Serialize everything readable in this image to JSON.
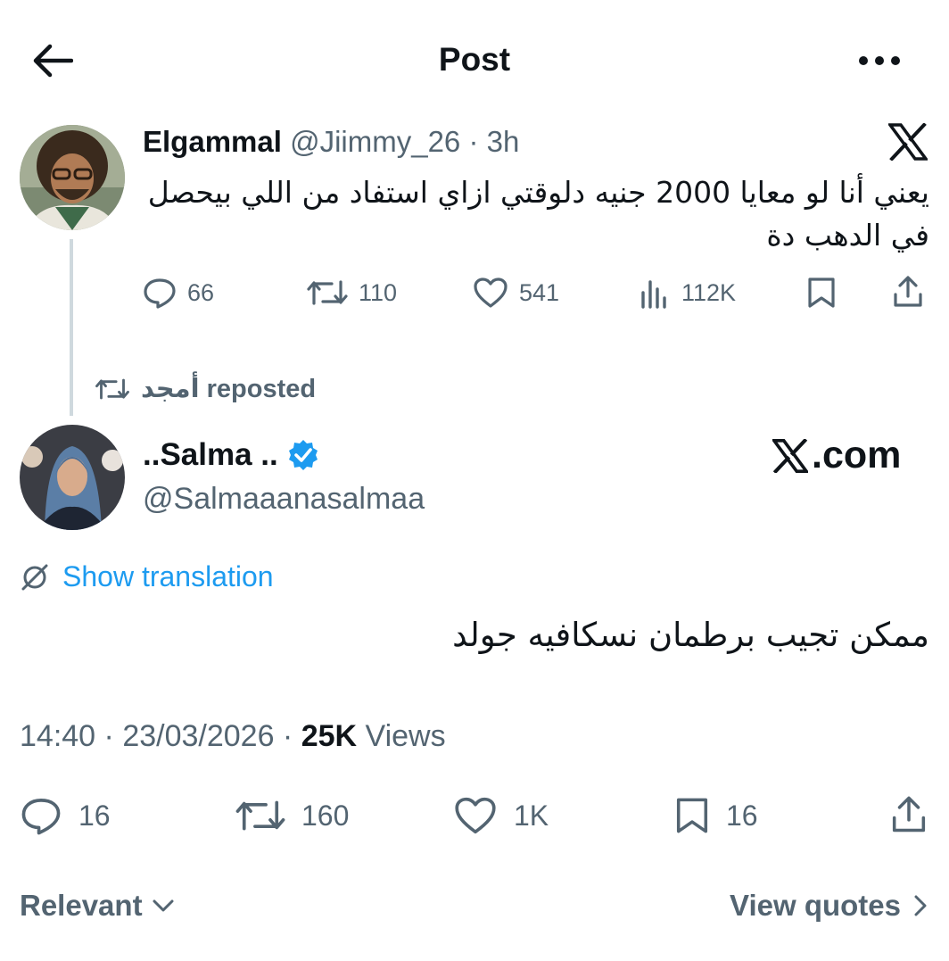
{
  "header": {
    "title": "Post"
  },
  "quoted": {
    "display_name": "Elgammal",
    "handle": "@Jiimmy_26",
    "separator": "·",
    "age": "3h",
    "text": "يعني أنا لو معايا 2000 جنيه دلوقتي ازاي استفاد من اللي بيحصل في الدهب دة",
    "stats": {
      "replies": "66",
      "reposts": "110",
      "likes": "541",
      "views": "112K"
    }
  },
  "repost_banner": {
    "text": "أمجد reposted"
  },
  "post": {
    "display_name": "..Salma ..",
    "handle": "@Salmaaanasalmaa",
    "watermark": ".com",
    "translate_label": "Show translation",
    "text": "ممكن تجيب برطمان نسكافيه جولد",
    "time": "14:40",
    "date": "23/03/2026",
    "sep": " · ",
    "views_count": "25K",
    "views_label": " Views",
    "stats": {
      "replies": "16",
      "reposts": "160",
      "likes": "1K",
      "bookmarks": "16"
    }
  },
  "footer": {
    "sort_label": "Relevant",
    "view_quotes_label": "View quotes"
  },
  "colors": {
    "text": "#0f1419",
    "muted": "#536471",
    "accent": "#1d9bf0"
  },
  "icons": [
    "back-arrow-icon",
    "more-icon",
    "x-logo-icon",
    "reply-icon",
    "repost-icon",
    "like-icon",
    "views-icon",
    "bookmark-icon",
    "share-icon",
    "verified-icon",
    "translate-icon",
    "chevron-down-icon",
    "chevron-right-icon"
  ]
}
